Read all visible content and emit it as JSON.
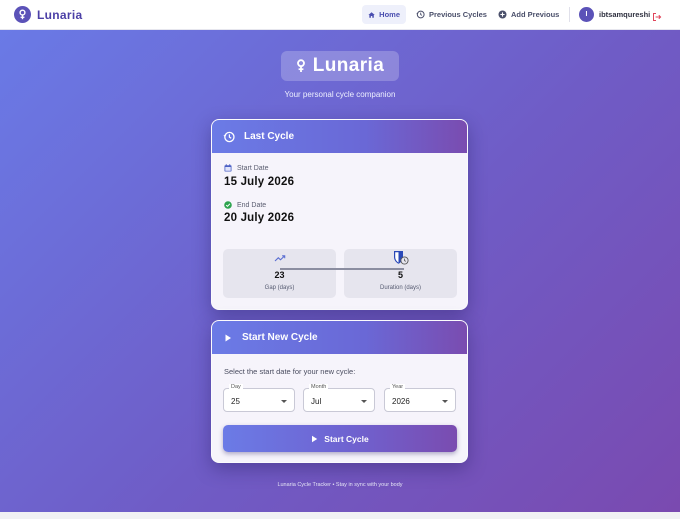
{
  "nav": {
    "brand": "Lunaria",
    "items": [
      {
        "label": "Home",
        "icon": "home-icon",
        "active": true
      },
      {
        "label": "Previous Cycles",
        "icon": "history-icon"
      },
      {
        "label": "Add Previous",
        "icon": "plus-circle-icon"
      }
    ],
    "user": {
      "initial": "I",
      "name": "ibtsamqureshi"
    },
    "logout_icon": "logout-icon"
  },
  "hero": {
    "title": "Lunaria",
    "subtitle": "Your personal cycle companion",
    "icon": "female-icon"
  },
  "last_cycle": {
    "title": "Last Cycle",
    "start_label": "Start Date",
    "start_value": "15 July 2026",
    "end_label": "End Date",
    "end_value": "20 July 2026",
    "gap": {
      "value": "23",
      "label": "Gap (days)"
    },
    "duration": {
      "value": "5",
      "label": "Duration (days)"
    }
  },
  "new_cycle": {
    "title": "Start New Cycle",
    "helper": "Select the start date for your new cycle:",
    "day": {
      "label": "Day",
      "value": "25"
    },
    "month": {
      "label": "Month",
      "value": "Jul"
    },
    "year": {
      "label": "Year",
      "value": "2026"
    },
    "button": "Start Cycle"
  },
  "footer": "Lunaria Cycle Tracker • Stay in sync with your body",
  "colors": {
    "brand": "#5b52b8",
    "gradient_start": "#6a7ae6",
    "gradient_end": "#7a4ab0",
    "success": "#2ea44f",
    "logout": "#e0445a"
  }
}
